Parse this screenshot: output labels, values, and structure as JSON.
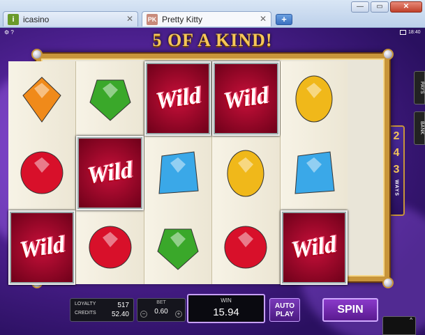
{
  "browser": {
    "tabs": [
      {
        "label": "icasino",
        "icon": "i"
      },
      {
        "label": "Pretty Kitty",
        "icon": "PK"
      }
    ],
    "new_tab": "+",
    "window_buttons": {
      "minimize": "—",
      "maximize": "▭",
      "close": "✕"
    }
  },
  "game": {
    "banner": "5 OF A KIND!",
    "ways_number": [
      "2",
      "4",
      "3"
    ],
    "ways_label": "WAYS",
    "side_tabs": {
      "pays": "PAYS",
      "bank": "BANK"
    },
    "clock": "18:40",
    "reels": [
      [
        "orange-gem",
        "red-gem",
        "wild"
      ],
      [
        "green-gem",
        "wild",
        "red-gem"
      ],
      [
        "wild",
        "blue-gem",
        "green-gem"
      ],
      [
        "wild",
        "yellow-gem",
        "red-gem"
      ],
      [
        "yellow-gem",
        "blue-gem",
        "wild"
      ]
    ],
    "wild_text": "Wild",
    "colors": {
      "orange-gem": "#f08a1a",
      "red-gem": "#d8102a",
      "green-gem": "#3aa82a",
      "blue-gem": "#3aa8e8",
      "yellow-gem": "#f0b81a"
    }
  },
  "controls": {
    "loyalty_label": "LOYALTY",
    "loyalty_value": "517",
    "credits_label": "CREDITS",
    "credits_value": "52.40",
    "bet_label": "BET",
    "bet_value": "0.60",
    "bet_minus": "−",
    "bet_plus": "+",
    "win_label": "WIN",
    "win_value": "15.94",
    "autoplay_label_1": "AUTO",
    "autoplay_label_2": "PLAY",
    "spin_label": "SPIN",
    "corner_arrow": "^"
  }
}
